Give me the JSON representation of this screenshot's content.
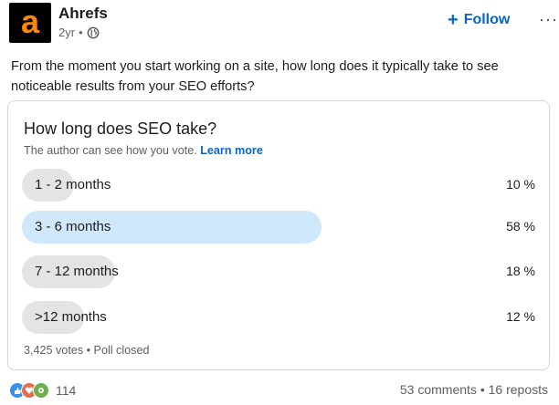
{
  "header": {
    "logo_letter": "a",
    "author": "Ahrefs",
    "time": "2yr",
    "follow_label": "Follow",
    "more_label": "···"
  },
  "post": {
    "text": "From the moment you start working on a site, how long does it typically take to see noticeable results from your SEO efforts?"
  },
  "poll": {
    "question": "How long does SEO take?",
    "note": "The author can see how you vote.",
    "learn_more": "Learn more",
    "options": [
      {
        "label": "1 - 2 months",
        "percent_text": "10 %",
        "percent": 10,
        "selected": false
      },
      {
        "label": "3 - 6 months",
        "percent_text": "58 %",
        "percent": 58,
        "selected": true
      },
      {
        "label": "7 - 12 months",
        "percent_text": "18 %",
        "percent": 18,
        "selected": false
      },
      {
        "label": ">12 months",
        "percent_text": "12 %",
        "percent": 12,
        "selected": false
      }
    ],
    "votes": "3,425 votes",
    "status": "Poll closed"
  },
  "social": {
    "reaction_count": "114",
    "comments": "53 comments",
    "reposts": "16 reposts"
  },
  "colors": {
    "brand_orange": "#ff8800",
    "link_blue": "#0a66c2",
    "selected_bar": "#d0e8fb",
    "bar": "#e4e4e4"
  }
}
